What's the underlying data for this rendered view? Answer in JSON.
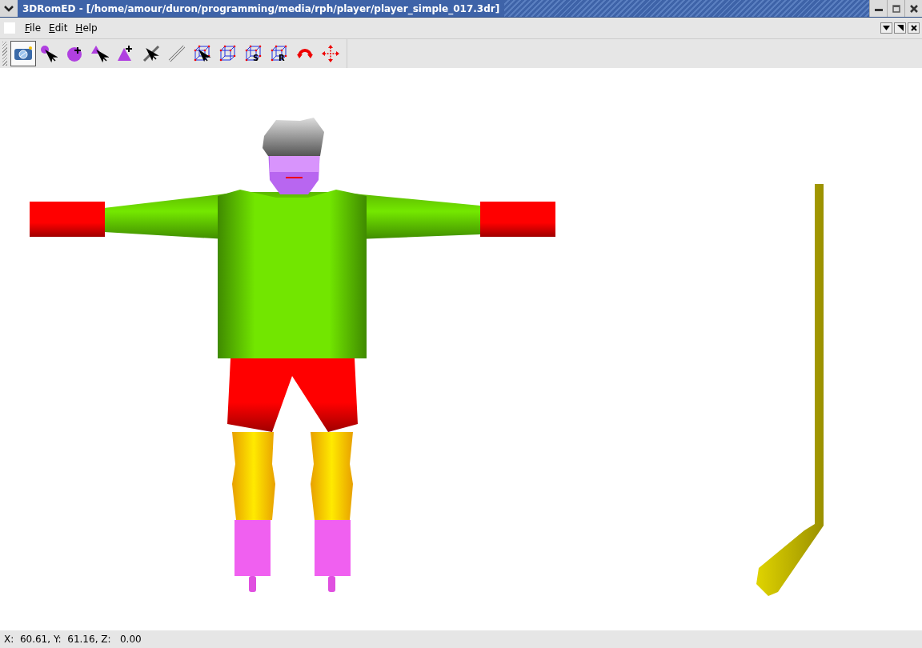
{
  "window": {
    "title": "3DRomED - [/home/amour/duron/programming/media/rph/player/player_simple_017.3dr]"
  },
  "menu": [
    {
      "label": "File"
    },
    {
      "label": "Edit"
    },
    {
      "label": "Help"
    }
  ],
  "toolbar": [
    {
      "kind": "camera",
      "selected": true
    },
    {
      "kind": "select-vertex",
      "selected": false
    },
    {
      "kind": "add-vertex",
      "selected": false
    },
    {
      "kind": "select-triangle",
      "selected": false
    },
    {
      "kind": "add-triangle",
      "selected": false
    },
    {
      "kind": "select-edge",
      "selected": false
    },
    {
      "kind": "edge",
      "selected": false
    },
    {
      "kind": "select-box",
      "selected": false
    },
    {
      "kind": "box",
      "selected": false
    },
    {
      "kind": "box-scale",
      "selected": false,
      "letter": "S"
    },
    {
      "kind": "box-rotate",
      "selected": false,
      "letter": "R"
    },
    {
      "kind": "rotate",
      "selected": false
    },
    {
      "kind": "move",
      "selected": false
    }
  ],
  "status_bar": "X:  60.61, Y:  61.16, Z:   0.00"
}
